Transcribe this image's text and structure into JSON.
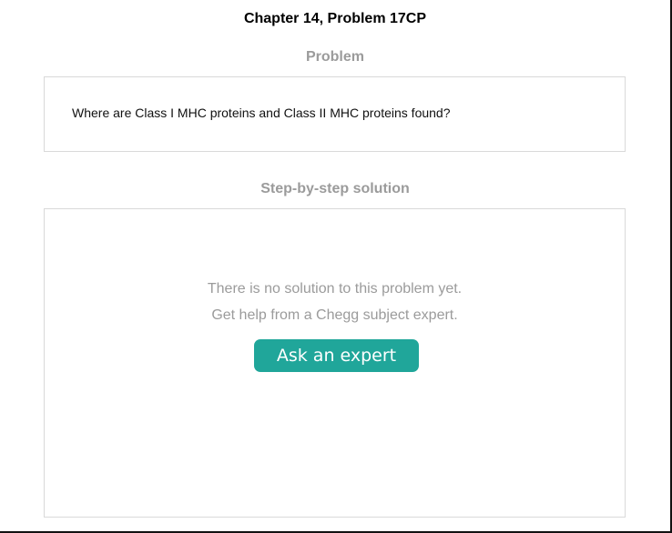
{
  "page": {
    "title": "Chapter 14, Problem 17CP"
  },
  "problem": {
    "heading": "Problem",
    "text": "Where are Class I MHC proteins and Class II MHC proteins found?"
  },
  "solution": {
    "heading": "Step-by-step solution",
    "empty_message_1": "There is no solution to this problem yet.",
    "empty_message_2": "Get help from a Chegg subject expert.",
    "button_label": "Ask an expert"
  },
  "colors": {
    "heading_gray": "#9b9b9b",
    "border_gray": "#d9d9d9",
    "accent_teal": "#20a69a"
  }
}
